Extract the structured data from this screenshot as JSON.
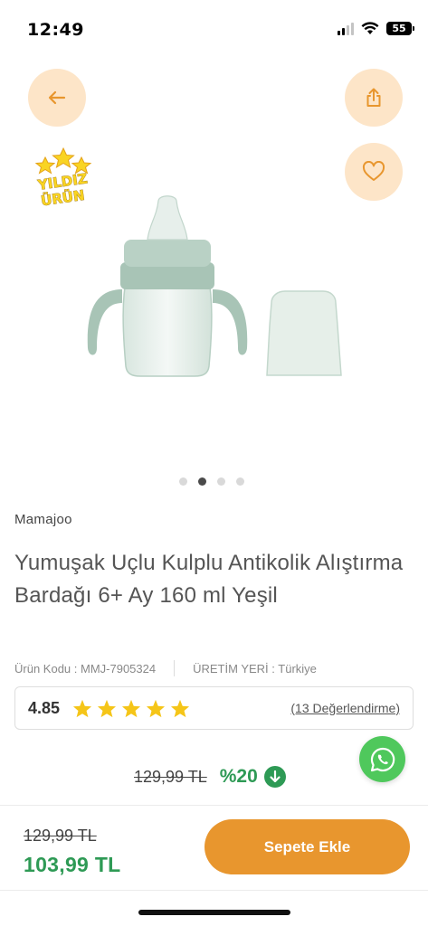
{
  "status_bar": {
    "time": "12:49",
    "battery": "55"
  },
  "badge": {
    "line1": "YILDIZ",
    "line2": "ÜRÜN"
  },
  "carousel": {
    "count": 4,
    "active_index": 1
  },
  "product": {
    "brand": "Mamajoo",
    "title": "Yumuşak Uçlu Kulplu Antikolik Alıştırma Bardağı 6+ Ay 160 ml Yeşil",
    "code_label": "Ürün Kodu :",
    "code_value": "MMJ-7905324",
    "origin_label": "ÜRETİM YERİ :",
    "origin_value": "Türkiye"
  },
  "rating": {
    "value": "4.85",
    "stars": 5,
    "reviews": "(13 Değerlendirme)"
  },
  "pricing": {
    "old_price": "129,99 TL",
    "discount": "%20",
    "new_price": "103,99 TL"
  },
  "actions": {
    "add_to_cart": "Sepete Ekle"
  },
  "colors": {
    "accent": "#e8962e",
    "soft_accent": "#fde5c8",
    "price_green": "#2e9a55",
    "whatsapp": "#4fc85c",
    "star": "#f5c518"
  }
}
